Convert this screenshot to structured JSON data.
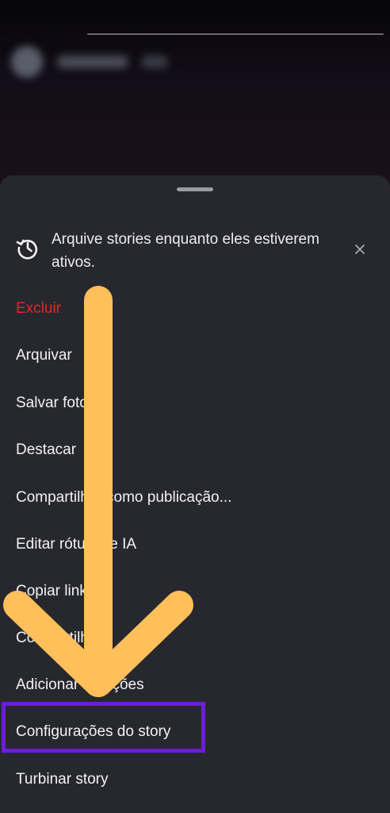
{
  "story": {
    "background_color": "#0b0a0f"
  },
  "sheet": {
    "background_color": "#27282d",
    "banner": {
      "icon": "history-icon",
      "text": "Arquive stories enquanto eles estiverem ativos.",
      "close_icon": "close-icon"
    },
    "menu": [
      {
        "label": "Excluir",
        "style": "danger",
        "color": "#e4252c"
      },
      {
        "label": "Arquivar"
      },
      {
        "label": "Salvar foto"
      },
      {
        "label": "Destacar"
      },
      {
        "label": "Compartilhar como publicação..."
      },
      {
        "label": "Editar rótulo de IA"
      },
      {
        "label": "Copiar link"
      },
      {
        "label": "Compartilhar"
      },
      {
        "label": "Adicionar menções"
      },
      {
        "label": "Configurações do story",
        "highlighted": true
      },
      {
        "label": "Turbinar story"
      }
    ]
  },
  "annotation": {
    "arrow_color": "#ffbf5a",
    "arrow_icon": "arrow-down-icon",
    "highlight_color": "#6a1ed9"
  }
}
